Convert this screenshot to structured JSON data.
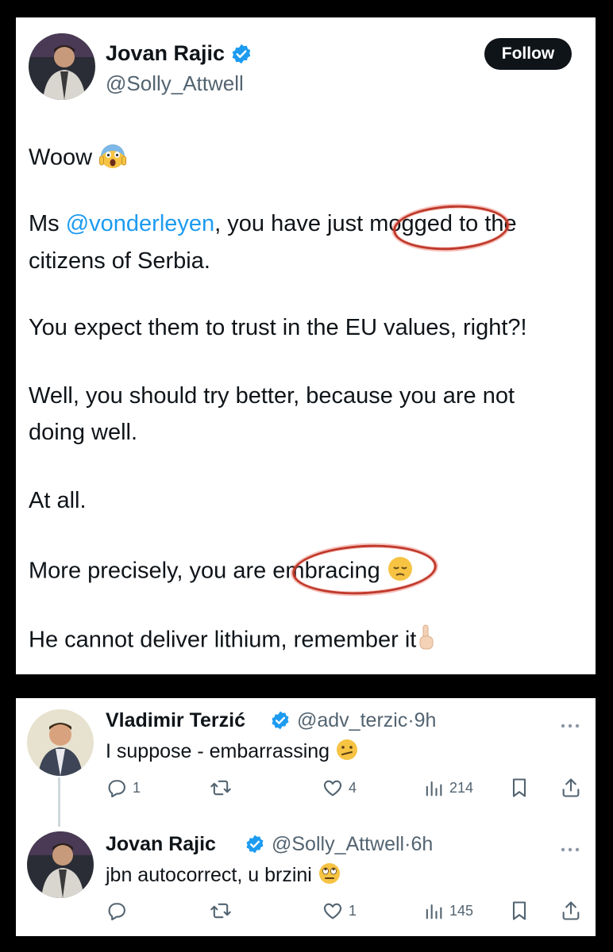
{
  "tweet": {
    "author_name": "Jovan Rajic",
    "author_handle": "@Solly_Attwell",
    "follow_label": "Follow",
    "lines": {
      "l1": "Woow",
      "l2_pre": "Ms ",
      "l2_mention": "@vonderleyen",
      "l2_post": ", you have just mogged to the",
      "l3": "citizens of Serbia.",
      "l4": "You expect them to trust in the EU values, right?!",
      "l5": "Well, you should try better, because you are not",
      "l6": "doing well.",
      "l7": "At all.",
      "l8": "More precisely, you are embracing",
      "l9": "He cannot deliver lithium, remember it"
    }
  },
  "replies": [
    {
      "name": "Vladimir Terzić",
      "handle": "@adv_terzic",
      "separator": "·",
      "time": "9h",
      "text": "I suppose - embarrassing",
      "reply_count": "1",
      "retweet_count": "",
      "like_count": "4",
      "view_count": "214"
    },
    {
      "name": "Jovan Rajic",
      "handle": "@Solly_Attwell",
      "separator": "·",
      "time": "6h",
      "text": "jbn autocorrect, u brzini",
      "reply_count": "",
      "retweet_count": "",
      "like_count": "1",
      "view_count": "145"
    }
  ],
  "colors": {
    "accent": "#1d9bf0",
    "text": "#0f1419",
    "muted": "#536471",
    "highlight_ring": "#c0392b"
  },
  "icons": [
    "verified-badge-icon",
    "scream-emoji",
    "pensive-emoji",
    "pointing-up-emoji",
    "confused-emoji",
    "eye-roll-emoji",
    "reply-icon",
    "retweet-icon",
    "like-icon",
    "views-icon",
    "bookmark-icon",
    "share-icon",
    "more-icon"
  ]
}
